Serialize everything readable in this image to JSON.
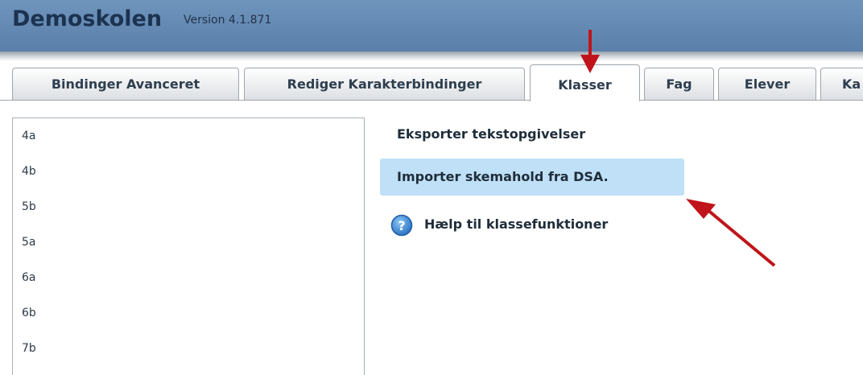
{
  "header": {
    "title": "Demoskolen",
    "version": "Version 4.1.871"
  },
  "tabs": [
    {
      "label": "Bindinger Avanceret",
      "active": false
    },
    {
      "label": "Rediger Karakterbindinger",
      "active": false
    },
    {
      "label": "Klasser",
      "active": true
    },
    {
      "label": "Fag",
      "active": false
    },
    {
      "label": "Elever",
      "active": false
    },
    {
      "label": "Ka",
      "active": false
    }
  ],
  "classes": [
    "4a",
    "4b",
    "5b",
    "5a",
    "6a",
    "6b",
    "7b"
  ],
  "actions": {
    "export_text": "Eksporter tekstopgivelser",
    "import_dsa": "Importer skemahold fra DSA.",
    "help": "Hælp til klassefunktioner"
  },
  "colors": {
    "header": "#6f95bd",
    "highlight": "#bfe0f7",
    "arrow": "#c0141a"
  },
  "icons": {
    "help": "question-circle-icon"
  }
}
